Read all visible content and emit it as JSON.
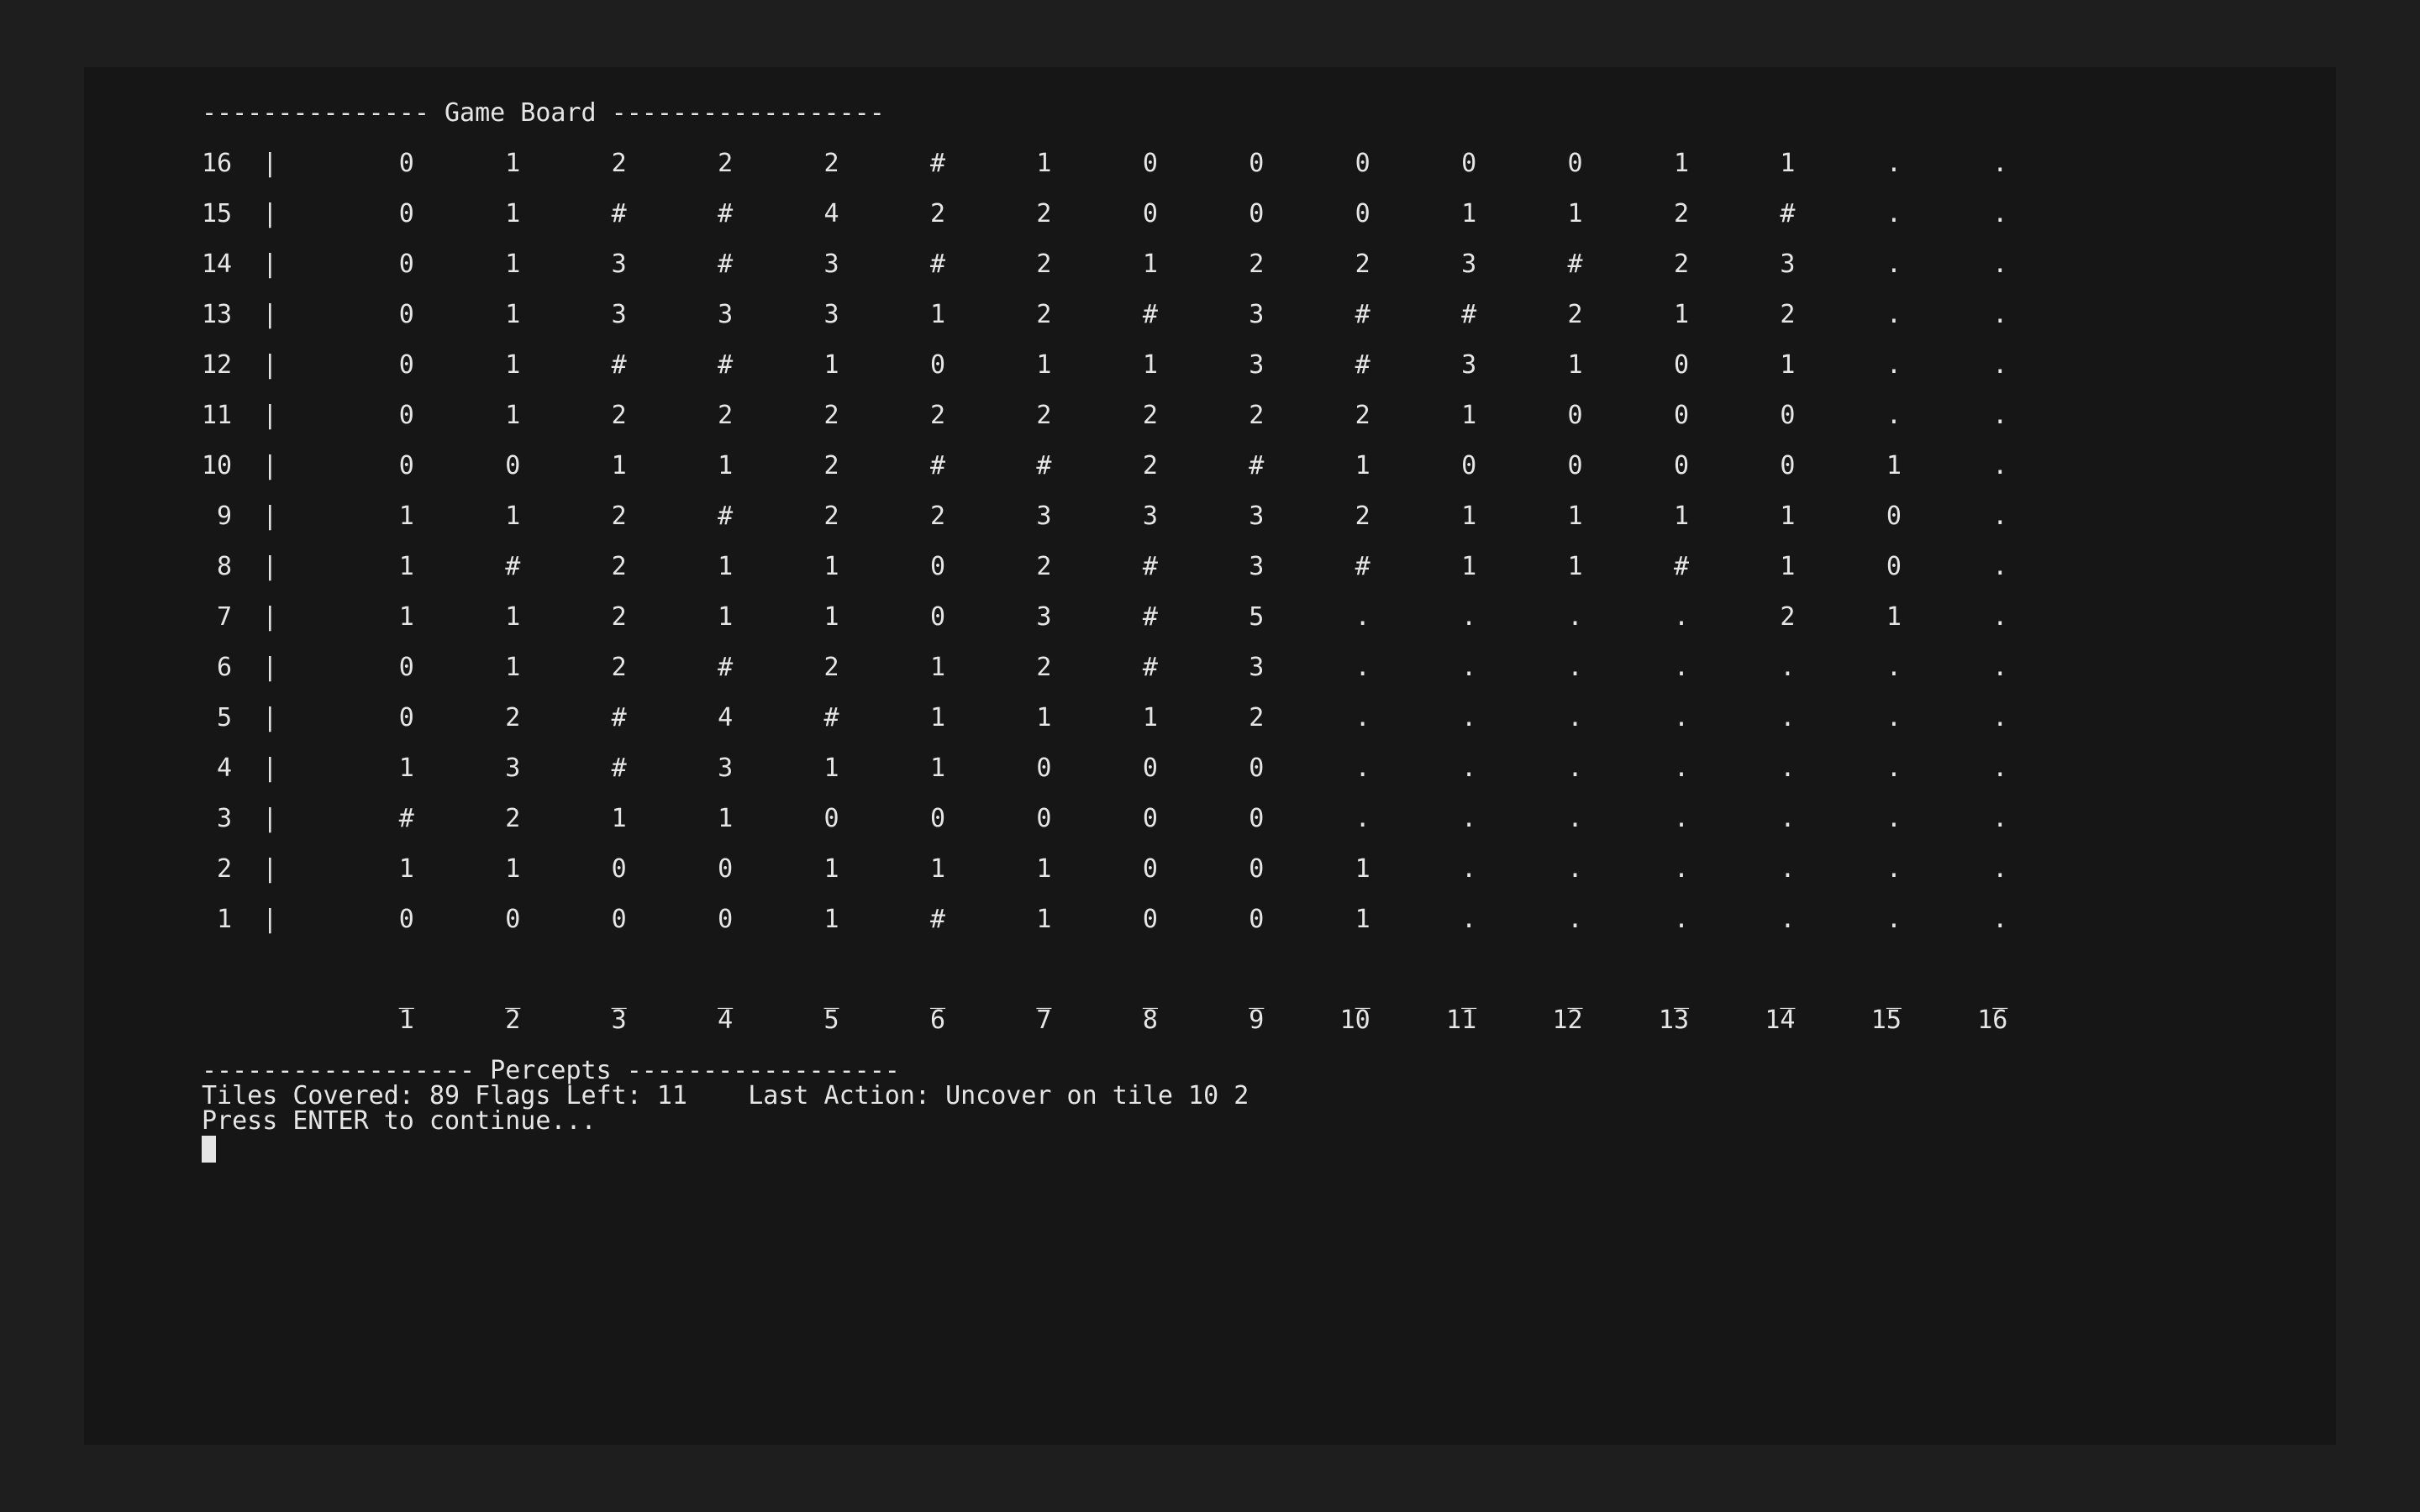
{
  "board": {
    "title_line": "--------------- Game Board ------------------",
    "col_labels": [
      "1",
      "2",
      "3",
      "4",
      "5",
      "6",
      "7",
      "8",
      "9",
      "10",
      "11",
      "12",
      "13",
      "14",
      "15",
      "16"
    ],
    "rows": [
      {
        "label": "16",
        "cells": [
          "0",
          "1",
          "2",
          "2",
          "2",
          "#",
          "1",
          "0",
          "0",
          "0",
          "0",
          "0",
          "1",
          "1",
          ".",
          "."
        ]
      },
      {
        "label": "15",
        "cells": [
          "0",
          "1",
          "#",
          "#",
          "4",
          "2",
          "2",
          "0",
          "0",
          "0",
          "1",
          "1",
          "2",
          "#",
          ".",
          "."
        ]
      },
      {
        "label": "14",
        "cells": [
          "0",
          "1",
          "3",
          "#",
          "3",
          "#",
          "2",
          "1",
          "2",
          "2",
          "3",
          "#",
          "2",
          "3",
          ".",
          "."
        ]
      },
      {
        "label": "13",
        "cells": [
          "0",
          "1",
          "3",
          "3",
          "3",
          "1",
          "2",
          "#",
          "3",
          "#",
          "#",
          "2",
          "1",
          "2",
          ".",
          "."
        ]
      },
      {
        "label": "12",
        "cells": [
          "0",
          "1",
          "#",
          "#",
          "1",
          "0",
          "1",
          "1",
          "3",
          "#",
          "3",
          "1",
          "0",
          "1",
          ".",
          "."
        ]
      },
      {
        "label": "11",
        "cells": [
          "0",
          "1",
          "2",
          "2",
          "2",
          "2",
          "2",
          "2",
          "2",
          "2",
          "1",
          "0",
          "0",
          "0",
          ".",
          "."
        ]
      },
      {
        "label": "10",
        "cells": [
          "0",
          "0",
          "1",
          "1",
          "2",
          "#",
          "#",
          "2",
          "#",
          "1",
          "0",
          "0",
          "0",
          "0",
          "1",
          "."
        ]
      },
      {
        "label": "9",
        "cells": [
          "1",
          "1",
          "2",
          "#",
          "2",
          "2",
          "3",
          "3",
          "3",
          "2",
          "1",
          "1",
          "1",
          "1",
          "0",
          "."
        ]
      },
      {
        "label": "8",
        "cells": [
          "1",
          "#",
          "2",
          "1",
          "1",
          "0",
          "2",
          "#",
          "3",
          "#",
          "1",
          "1",
          "#",
          "1",
          "0",
          "."
        ]
      },
      {
        "label": "7",
        "cells": [
          "1",
          "1",
          "2",
          "1",
          "1",
          "0",
          "3",
          "#",
          "5",
          ".",
          ".",
          ".",
          ".",
          "2",
          "1",
          "."
        ]
      },
      {
        "label": "6",
        "cells": [
          "0",
          "1",
          "2",
          "#",
          "2",
          "1",
          "2",
          "#",
          "3",
          ".",
          ".",
          ".",
          ".",
          ".",
          ".",
          "."
        ]
      },
      {
        "label": "5",
        "cells": [
          "0",
          "2",
          "#",
          "4",
          "#",
          "1",
          "1",
          "1",
          "2",
          ".",
          ".",
          ".",
          ".",
          ".",
          ".",
          "."
        ]
      },
      {
        "label": "4",
        "cells": [
          "1",
          "3",
          "#",
          "3",
          "1",
          "1",
          "0",
          "0",
          "0",
          ".",
          ".",
          ".",
          ".",
          ".",
          ".",
          "."
        ]
      },
      {
        "label": "3",
        "cells": [
          "#",
          "2",
          "1",
          "1",
          "0",
          "0",
          "0",
          "0",
          "0",
          ".",
          ".",
          ".",
          ".",
          ".",
          ".",
          "."
        ]
      },
      {
        "label": "2",
        "cells": [
          "1",
          "1",
          "0",
          "0",
          "1",
          "1",
          "1",
          "0",
          "0",
          "1",
          ".",
          ".",
          ".",
          ".",
          ".",
          "."
        ]
      },
      {
        "label": "1",
        "cells": [
          "0",
          "0",
          "0",
          "0",
          "1",
          "#",
          "1",
          "0",
          "0",
          "1",
          ".",
          ".",
          ".",
          ".",
          ".",
          "."
        ]
      }
    ]
  },
  "percepts": {
    "title_line": "------------------ Percepts ------------------",
    "tiles_covered_label": "Tiles Covered:",
    "tiles_covered": "89",
    "flags_left_label": "Flags Left:",
    "flags_left": "11",
    "last_action_label": "Last Action:",
    "last_action": "Uncover on tile 10 2",
    "prompt": "Press ENTER to continue..."
  }
}
